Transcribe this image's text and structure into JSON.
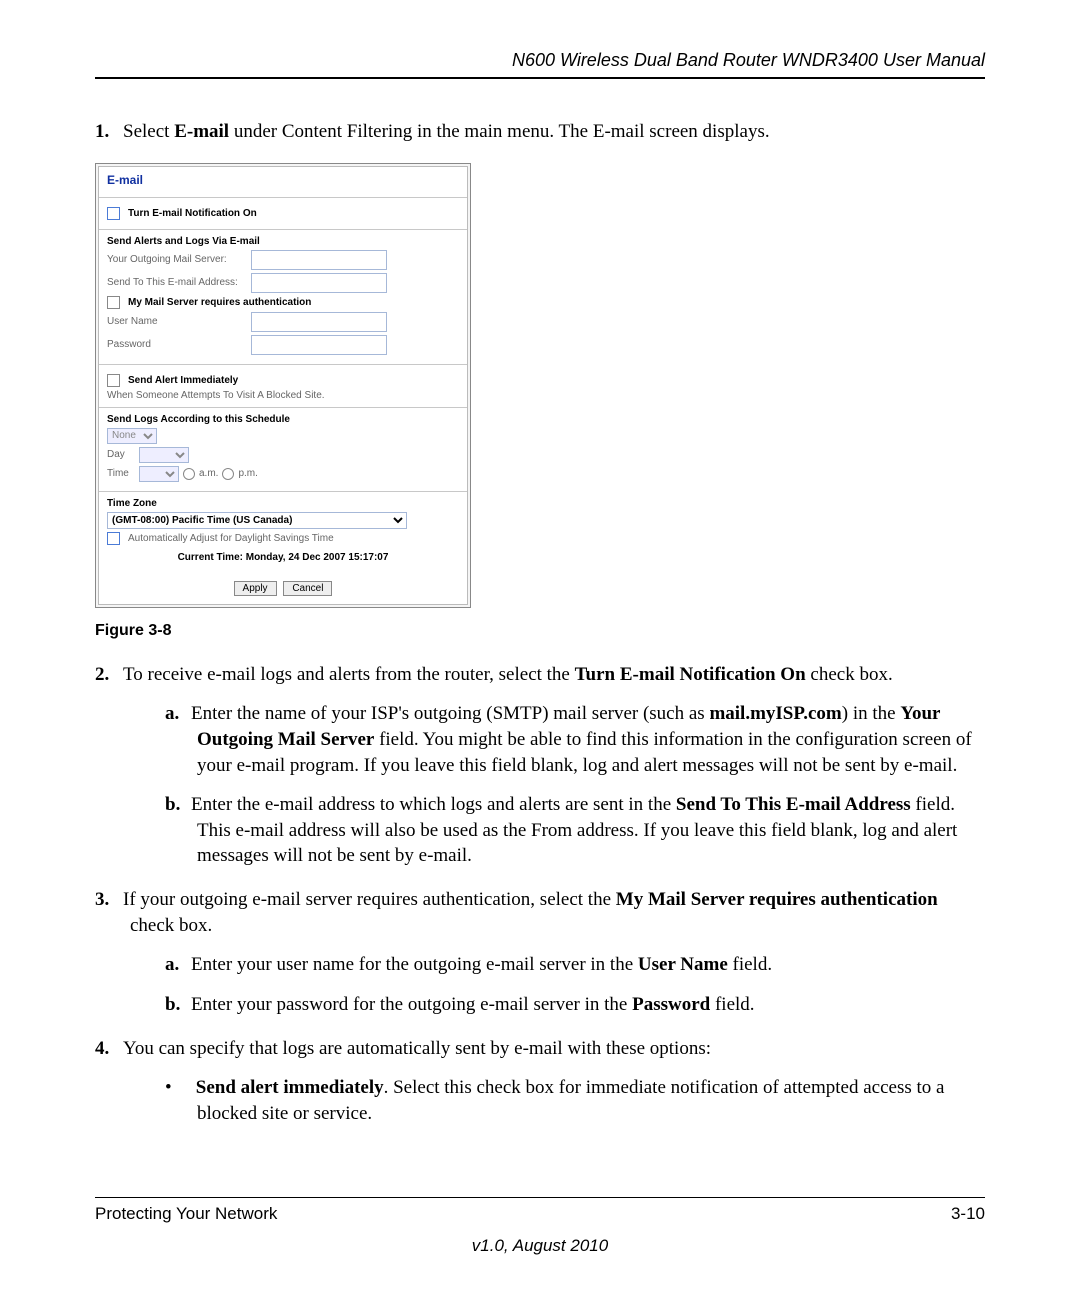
{
  "header": {
    "title": "N600 Wireless Dual Band Router WNDR3400 User Manual"
  },
  "step1": {
    "num": "1.",
    "pre": "Select ",
    "bold": "E-mail",
    "post": " under Content Filtering in the main menu. The E-mail screen displays."
  },
  "figure_caption": "Figure 3-8",
  "screenshot": {
    "title": "E-mail",
    "turn_on": "Turn E-mail Notification On",
    "section1_heading": "Send Alerts and Logs Via E-mail",
    "outgoing_label": "Your Outgoing Mail Server:",
    "sendto_label": "Send To This E-mail Address:",
    "auth_required": "My Mail Server requires authentication",
    "username_label": "User Name",
    "password_label": "Password",
    "alert_immediate": "Send Alert Immediately",
    "alert_desc": "When Someone Attempts To Visit A Blocked Site.",
    "schedule_heading": "Send Logs According to this Schedule",
    "schedule_value": "None",
    "day_label": "Day",
    "time_label": "Time",
    "am": "a.m.",
    "pm": "p.m.",
    "tz_heading": "Time Zone",
    "tz_value": "(GMT-08:00) Pacific Time (US Canada)",
    "dst": "Automatically Adjust for Daylight Savings Time",
    "current_time": "Current Time:   Monday, 24 Dec 2007 15:17:07",
    "apply": "Apply",
    "cancel": "Cancel"
  },
  "step2": {
    "num": "2.",
    "t1": "To receive e-mail logs and alerts from the router, select the ",
    "b1": "Turn E-mail Notification On",
    "t2": " check box.",
    "a": {
      "num": "a.",
      "t1": "Enter the name of your ISP's outgoing (SMTP) mail server (such as ",
      "b1": "mail.myISP.com",
      "t2": ") in the ",
      "b2": "Your Outgoing Mail Server",
      "t3": " field. You might be able to find this information in the configuration screen of your e-mail program. If you leave this field blank, log and alert messages will not be sent by e-mail."
    },
    "b": {
      "num": "b.",
      "t1": "Enter the e-mail address to which logs and alerts are sent in the ",
      "b1": "Send To This E-mail Address",
      "t2": " field. This e-mail address will also be used as the From address. If you leave this field blank, log and alert messages will not be sent by e-mail."
    }
  },
  "step3": {
    "num": "3.",
    "t1": "If your outgoing e-mail server requires authentication, select the ",
    "b1": "My Mail Server requires authentication",
    "t2": " check box.",
    "a": {
      "num": "a.",
      "t1": "Enter your user name for the outgoing e-mail server in the ",
      "b1": "User Name",
      "t2": " field."
    },
    "b": {
      "num": "b.",
      "t1": "Enter your password for the outgoing e-mail server in the ",
      "b1": "Password",
      "t2": " field."
    }
  },
  "step4": {
    "num": "4.",
    "text": "You can specify that logs are automatically sent by e-mail with these options:",
    "bullet": {
      "b1": "Send alert immediately",
      "t1": ". Select this check box for immediate notification of attempted access to a blocked site or service."
    }
  },
  "footer": {
    "left": "Protecting Your Network",
    "right": "3-10",
    "version": "v1.0, August 2010"
  }
}
